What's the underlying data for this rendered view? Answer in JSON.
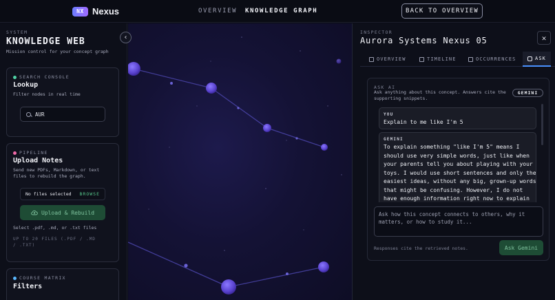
{
  "header": {
    "logo_badge": "NX",
    "logo_text": "Nexus",
    "nav_overview": "OVERVIEW",
    "nav_graph": "KNOWLEDGE GRAPH",
    "back_button": "BACK TO OVERVIEW"
  },
  "sidebar": {
    "eyebrow": "SYSTEM",
    "title": "KNOWLEDGE WEB",
    "subtitle": "Mission control for your concept graph",
    "collapse_icon": "chevron-left-icon",
    "search_card": {
      "eyebrow": "SEARCH CONSOLE",
      "dot_color": "#4fd1a5",
      "title": "Lookup",
      "text": "Filter nodes in real time",
      "input_value": "AUR",
      "icon": "search-icon"
    },
    "pipeline_card": {
      "eyebrow": "PIPELINE",
      "dot_color": "#f06aa8",
      "title": "Upload Notes",
      "text": "Send new PDFs, Markdown, or text files to rebuild the graph.",
      "file_status": "No files selected",
      "browse": "BROWSE",
      "upload_button": "Upload & Rebuild",
      "hint": "Select .pdf, .md, or .txt files",
      "limit": "UP TO 20 FILES (.PDF / .MD / .TXT)"
    },
    "filters_card": {
      "eyebrow": "COURSE MATRIX",
      "dot_color": "#5ab8ff",
      "title": "Filters"
    }
  },
  "inspector": {
    "eyebrow": "INSPECTOR",
    "title": "Aurora Systems Nexus 05",
    "close_icon": "close-icon",
    "tabs": [
      {
        "label": "OVERVIEW",
        "icon": "book-icon"
      },
      {
        "label": "TIMELINE",
        "icon": "calendar-icon"
      },
      {
        "label": "OCCURRENCES",
        "icon": "document-icon"
      },
      {
        "label": "ASK",
        "icon": "chat-icon"
      }
    ],
    "ask": {
      "eyebrow": "ASK AI",
      "description": "Ask anything about this concept. Answers cite the supporting snippets.",
      "badge": "GEMINI",
      "messages": [
        {
          "who": "YOU",
          "text": "Explain to me like I'm 5"
        },
        {
          "who": "GEMINI",
          "text": "To explain something \"like I'm 5\" means I should use very simple words, just like when your parents tell you about playing with your toys. I would use short sentences and only the easiest ideas, without any big, grown-up words that might be confusing. However, I do not have enough information right now to explain"
        }
      ],
      "input_placeholder": "Ask how this concept connects to others, why it matters, or how to study it...",
      "footnote": "Responses cite the retrieved notes.",
      "button": "Ask Gemini"
    }
  },
  "colors": {
    "accent_green": "#1e4c35",
    "node": "#6a55e0",
    "tab_underline": "#4a91ff"
  }
}
